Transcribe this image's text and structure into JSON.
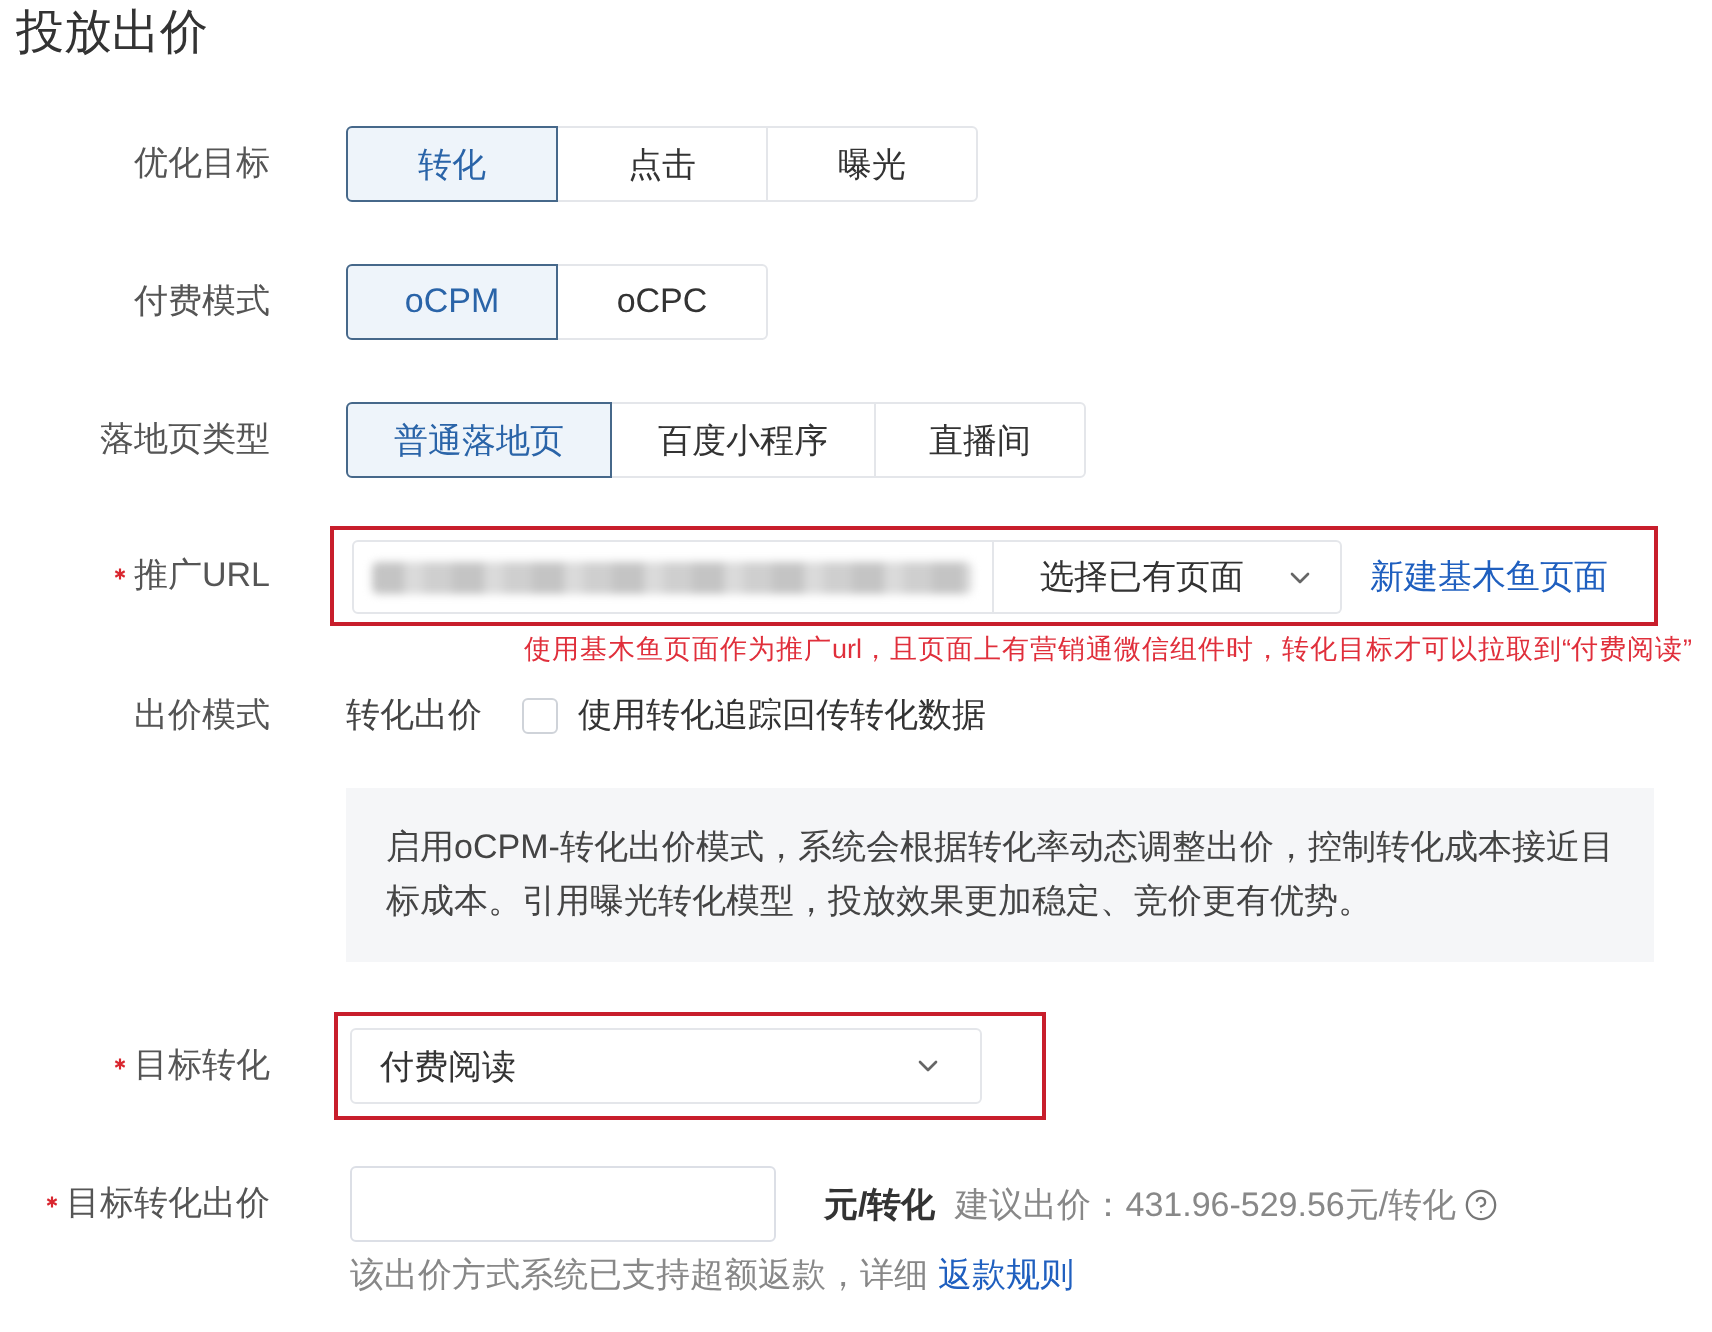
{
  "title": "投放出价",
  "fields": [
    {
      "kind": "segmented",
      "label": "优化目标",
      "required": false,
      "highlighted": false,
      "options": [
        {
          "label": "转化",
          "selected": true
        },
        {
          "label": "点击",
          "selected": false
        },
        {
          "label": "曝光",
          "selected": false
        }
      ]
    },
    {
      "kind": "segmented",
      "label": "付费模式",
      "required": false,
      "highlighted": false,
      "options": [
        {
          "label": "oCPM",
          "selected": true
        },
        {
          "label": "oCPC",
          "selected": false
        }
      ]
    },
    {
      "kind": "segmented",
      "label": "落地页类型",
      "required": false,
      "highlighted": false,
      "options": [
        {
          "label": "普通落地页",
          "selected": true
        },
        {
          "label": "百度小程序",
          "selected": false
        },
        {
          "label": "直播间",
          "selected": false
        }
      ]
    },
    {
      "kind": "url",
      "label": "推广URL",
      "required": true,
      "highlighted": true,
      "redacted": true,
      "page_select": "选择已有页面",
      "create_link": "新建基木鱼页面",
      "note": "使用基木鱼页面作为推广url，且页面上有营销通微信组件时，转化目标才可以拉取到“付费阅读”"
    },
    {
      "kind": "bid_mode",
      "label": "出价模式",
      "required": false,
      "highlighted": false,
      "mode": "转化出价",
      "checkbox": {
        "label": "使用转化追踪回传转化数据",
        "checked": false
      },
      "info": "启用oCPM-转化出价模式，系统会根据转化率动态调整出价，控制转化成本接近目标成本。引用曝光转化模型，投放效果更加稳定、竞价更有优势。"
    },
    {
      "kind": "select",
      "label": "目标转化",
      "required": true,
      "highlighted": true,
      "value": "付费阅读"
    },
    {
      "kind": "bid_input",
      "label": "目标转化出价",
      "required": true,
      "highlighted": false,
      "unit": "元/转化",
      "suggestion": "建议出价：431.96-529.56元/转化",
      "hint": "该出价方式系统已支持超额返款，详细",
      "hint_link": "返款规则"
    }
  ]
}
